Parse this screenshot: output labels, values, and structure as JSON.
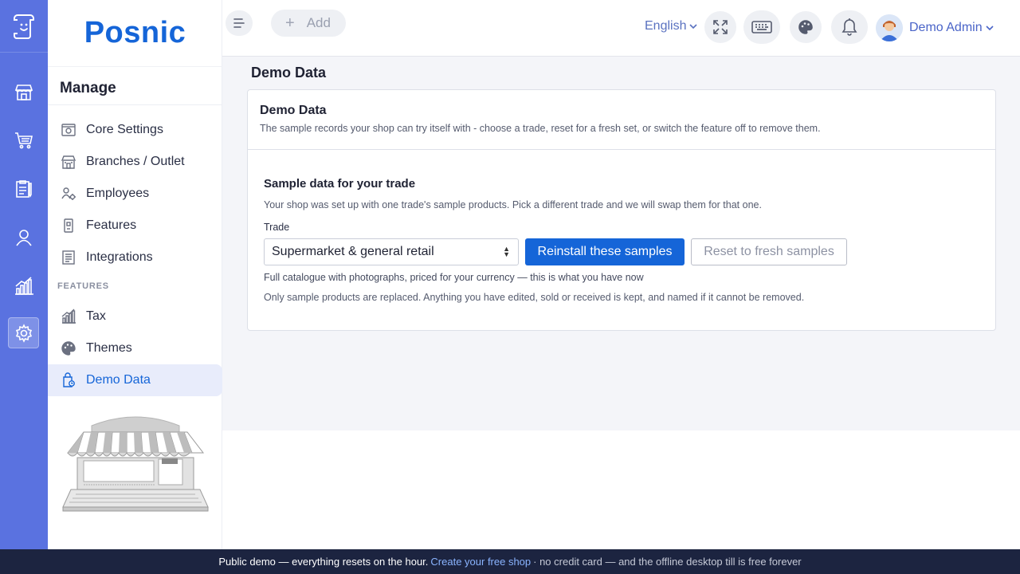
{
  "brand": {
    "name": "Posnic"
  },
  "topbar": {
    "add_label": "Add",
    "language": "English",
    "user_name": "Demo Admin"
  },
  "sidebar": {
    "heading": "Manage",
    "items": [
      {
        "label": "Core Settings",
        "icon": "settings-icon"
      },
      {
        "label": "Branches / Outlet",
        "icon": "store-icon"
      },
      {
        "label": "Employees",
        "icon": "employees-icon"
      },
      {
        "label": "Features",
        "icon": "features-icon"
      },
      {
        "label": "Integrations",
        "icon": "integrations-icon"
      }
    ],
    "section_label": "FEATURES",
    "feature_items": [
      {
        "label": "Tax",
        "icon": "tax-icon"
      },
      {
        "label": "Themes",
        "icon": "palette-icon"
      },
      {
        "label": "Demo Data",
        "icon": "demo-data-icon",
        "active": true
      }
    ]
  },
  "page": {
    "title": "Demo Data",
    "card": {
      "title": "Demo Data",
      "description": "The sample records your shop can try itself with - choose a trade, reset for a fresh set, or switch the feature off to remove them.",
      "section_title": "Sample data for your trade",
      "section_description": "Your shop was set up with one trade's sample products. Pick a different trade and we will swap them for that one.",
      "trade_label": "Trade",
      "trade_selected": "Supermarket & general retail",
      "reinstall_label": "Reinstall these samples",
      "reset_label": "Reset to fresh samples",
      "hint_current": "Full catalogue with photographs, priced for your currency — this is what you have now",
      "hint_note": "Only sample products are replaced. Anything you have edited, sold or received is kept, and named if it cannot be removed."
    }
  },
  "banner": {
    "text_before": "Public demo — everything resets on the hour.",
    "link": "Create your free shop",
    "text_after": "· no credit card — and the offline desktop till is free forever"
  },
  "colors": {
    "rail": "#5a72e0",
    "primary": "#1565d8",
    "banner": "#1c2440"
  }
}
